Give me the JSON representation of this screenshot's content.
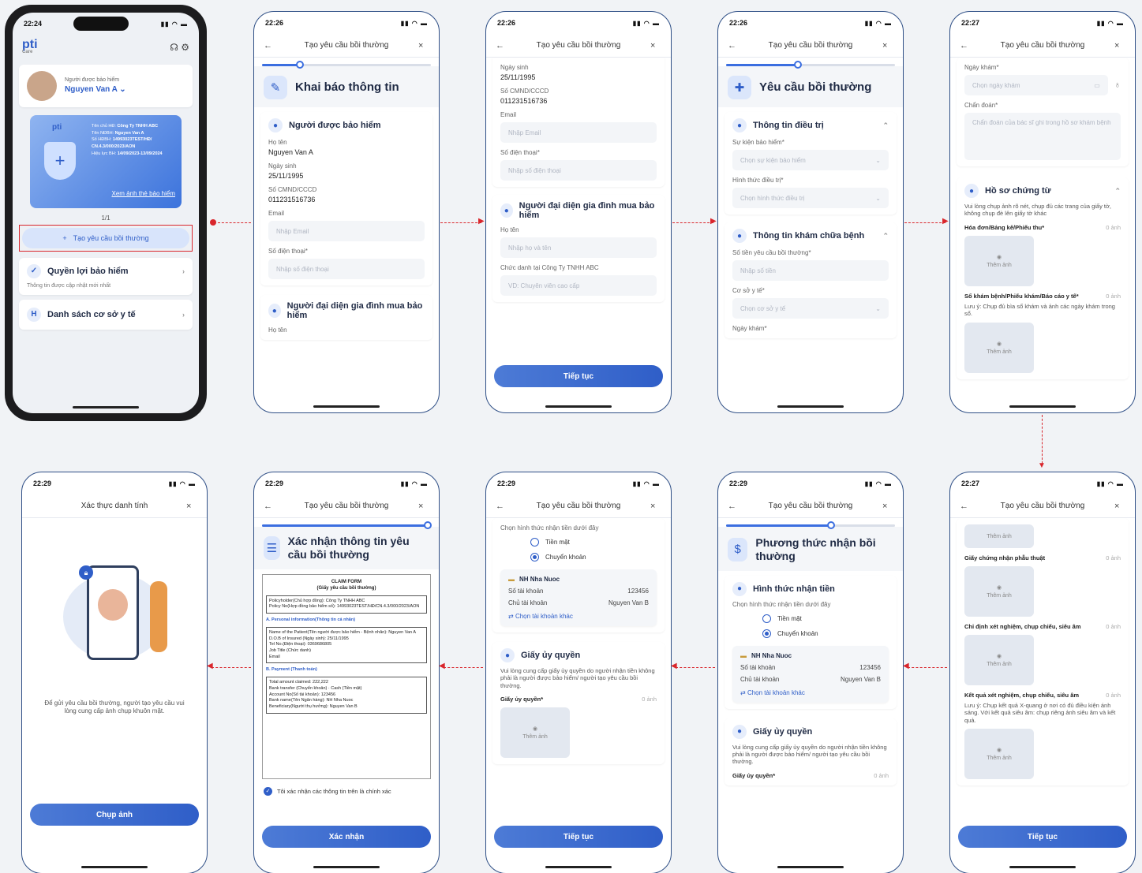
{
  "colors": {
    "accent": "#2f5ec8",
    "arrow": "#d9262c"
  },
  "p1": {
    "time": "22:24",
    "logo": "pti",
    "logo_sub": "Care",
    "insured_label": "Người được bảo hiểm",
    "insured_name": "Nguyen Van A",
    "card_company_label": "Tên chủ HĐ",
    "card_company": "Công Ty TNHH ABC",
    "card_name_label": "Tên NĐBH",
    "card_name": "Nguyen Van A",
    "card_policy_label": "Số HĐBH",
    "card_policy": "14993023TEST/HĐ/ CN.4.3/000/2023/AON",
    "card_term_label": "Hiệu lực BH",
    "card_term": "14/09/2023-13/09/2024",
    "card_link": "Xem ảnh thẻ bảo hiểm",
    "pager": "1/1",
    "create_btn": "Tạo yêu cầu bồi thường",
    "benefit_title": "Quyền lợi bảo hiểm",
    "benefit_sub": "Thông tin được cập nhật mới nhất",
    "facility": "Danh sách cơ sở y tế"
  },
  "p2": {
    "time": "22:26",
    "nav": "Tạo yêu cầu bồi thường",
    "header": "Khai báo thông tin",
    "section1": "Người được bảo hiểm",
    "name_label": "Họ tên",
    "name": "Nguyen Van A",
    "dob_label": "Ngày sinh",
    "dob": "25/11/1995",
    "id_label": "Số CMND/CCCD",
    "id": "011231516736",
    "email_label": "Email",
    "email_ph": "Nhập Email",
    "phone_label": "Số điện thoại*",
    "phone_ph": "Nhập số điện thoại",
    "section2": "Người đại diện gia đình mua bảo hiểm",
    "name2_label": "Họ tên"
  },
  "p3": {
    "time": "22:26",
    "nav": "Tạo yêu cầu bồi thường",
    "dob_label": "Ngày sinh",
    "dob": "25/11/1995",
    "id_label": "Số CMND/CCCD",
    "id": "011231516736",
    "email_label": "Email",
    "email_ph": "Nhập Email",
    "phone_label": "Số điện thoại*",
    "phone_ph": "Nhập số điện thoại",
    "section2": "Người đại diện gia đình mua bảo hiểm",
    "name_label": "Họ tên",
    "name_ph": "Nhập họ và tên",
    "title_label": "Chức danh tại Công Ty TNHH ABC",
    "title_ph": "VD: Chuyên viên cao cấp",
    "btn": "Tiếp tục"
  },
  "p4": {
    "time": "22:26",
    "nav": "Tạo yêu cầu bồi thường",
    "header": "Yêu cầu bồi thường",
    "sec1": "Thông tin điều trị",
    "event_label": "Sự kiện bảo hiểm*",
    "event_ph": "Chọn sự kiện bảo hiểm",
    "form_label": "Hình thức điều trị*",
    "form_ph": "Chọn hình thức điều trị",
    "sec2": "Thông tin khám chữa bệnh",
    "amount_label": "Số tiền yêu cầu bồi thường*",
    "amount_ph": "Nhập số tiền",
    "facility_label": "Cơ sở y tế*",
    "facility_ph": "Chọn cơ sở y tế",
    "date_label": "Ngày khám*"
  },
  "p5": {
    "time": "22:27",
    "nav": "Tạo yêu cầu bồi thường",
    "date_label": "Ngày khám*",
    "date_ph": "Chọn ngày khám",
    "diag_label": "Chẩn đoán*",
    "diag_ph": "Chẩn đoán của bác sĩ ghi trong hồ sơ khám bệnh",
    "sec": "Hồ sơ chứng từ",
    "sec_note": "Vui lòng chụp ảnh rõ nét, chụp đủ các trang của giấy tờ, không chụp đè lên giấy tờ khác",
    "doc1": "Hóa đơn/Bảng kê/Phiếu thu*",
    "count": "0 ảnh",
    "add": "Thêm ảnh",
    "doc2": "Sổ khám bệnh/Phiếu khám/Báo cáo y tế*",
    "doc2_note": "Lưu ý: Chụp đủ bìa sổ khám và ảnh các ngày khám trong sổ."
  },
  "p6": {
    "time": "22:29",
    "nav": "Xác thực danh tính",
    "text": "Để gửi yêu cầu bồi thường, người tạo yêu cầu vui lòng cung cấp ảnh chụp khuôn mặt.",
    "btn": "Chụp ảnh"
  },
  "p7": {
    "time": "22:29",
    "nav": "Tạo yêu cầu bồi thường",
    "header": "Xác nhận thông tin yêu cầu bồi thường",
    "form_title": "CLAIM FORM",
    "form_sub": "(Giấy yêu cầu bồi thường)",
    "holder": "Policyholder(Chủ hợp đồng): Công Ty TNHH ABC",
    "policy": "Policy No(Hợp đồng bảo hiểm số): 14993023TEST/HĐ/CN.4.3/000/2023/AON",
    "sec_a": "A. Personal information(Thông tin cá nhân)",
    "patient": "Name of the Patient(Tên người được bảo hiểm - Bệnh nhân): Nguyen Van A",
    "dob": "D.O.B of Insured (Ngày sinh): 25/11/1995",
    "tel": "Tel No.(Điện thoại): 0369686805",
    "job": "Job Title (Chức danh)",
    "email": "Email",
    "sec_b": "B. Payment (Thanh toán)",
    "total": "Total amount claimed: 222,222",
    "bank": "Bank transfer (Chuyển khoản)",
    "cash": "Cash (Tiền mặt)",
    "acc": "Account No(Số tài khoản): 123456",
    "bank_name": "Bank name(Tên Ngân hàng): NH Nha Nuoc",
    "bene": "Beneficiary(Người thụ hưởng): Nguyen Van B",
    "confirm": "Tôi xác nhận các thông tin trên là chính xác",
    "btn": "Xác nhận"
  },
  "p8": {
    "time": "22:29",
    "nav": "Tạo yêu cầu bồi thường",
    "choose": "Chọn hình thức nhận tiền dưới đây",
    "cash": "Tiền mặt",
    "transfer": "Chuyển khoản",
    "bank": "NH Nha Nuoc",
    "acc_label": "Số tài khoản",
    "acc": "123456",
    "owner_label": "Chủ tài khoản",
    "owner": "Nguyen Van B",
    "other": "Chọn tài khoản khác",
    "auth": "Giấy ủy quyền",
    "auth_note": "Vui lòng cung cấp giấy ủy quyền do người nhận tiền không phải là người được bảo hiểm/ người tạo yêu cầu bồi thường.",
    "auth_sub": "Giấy ủy quyền*",
    "count": "0 ảnh",
    "add": "Thêm ảnh",
    "btn": "Tiếp tục"
  },
  "p9": {
    "time": "22:29",
    "nav": "Tạo yêu cầu bồi thường",
    "header": "Phương thức nhận bồi thường",
    "sec": "Hình thức nhận tiền",
    "choose": "Chọn hình thức nhận tiền dưới đây",
    "cash": "Tiền mặt",
    "transfer": "Chuyển khoản",
    "bank": "NH Nha Nuoc",
    "acc_label": "Số tài khoản",
    "acc": "123456",
    "owner_label": "Chủ tài khoản",
    "owner": "Nguyen Van B",
    "other": "Chọn tài khoản khác",
    "auth": "Giấy ủy quyền",
    "auth_note": "Vui lòng cung cấp giấy ủy quyền do người nhận tiền không phải là người được bảo hiểm/ người tạo yêu cầu bồi thường.",
    "auth_sub": "Giấy ủy quyền*",
    "count": "0 ảnh"
  },
  "p10": {
    "time": "22:27",
    "nav": "Tạo yêu cầu bồi thường",
    "add": "Thêm ảnh",
    "count": "0 ảnh",
    "doc1": "Giấy chứng nhận phẫu thuật",
    "doc2": "Chỉ định xét nghiệm, chụp chiếu, siêu âm",
    "doc3": "Kết quả xét nghiệm, chụp chiếu, siêu âm",
    "doc3_note": "Lưu ý: Chụp kết quả X-quang ở nơi có đủ điều kiện ánh sáng. Với kết quả siêu âm: chụp riêng ảnh siêu âm và kết quả.",
    "btn": "Tiếp tục"
  }
}
